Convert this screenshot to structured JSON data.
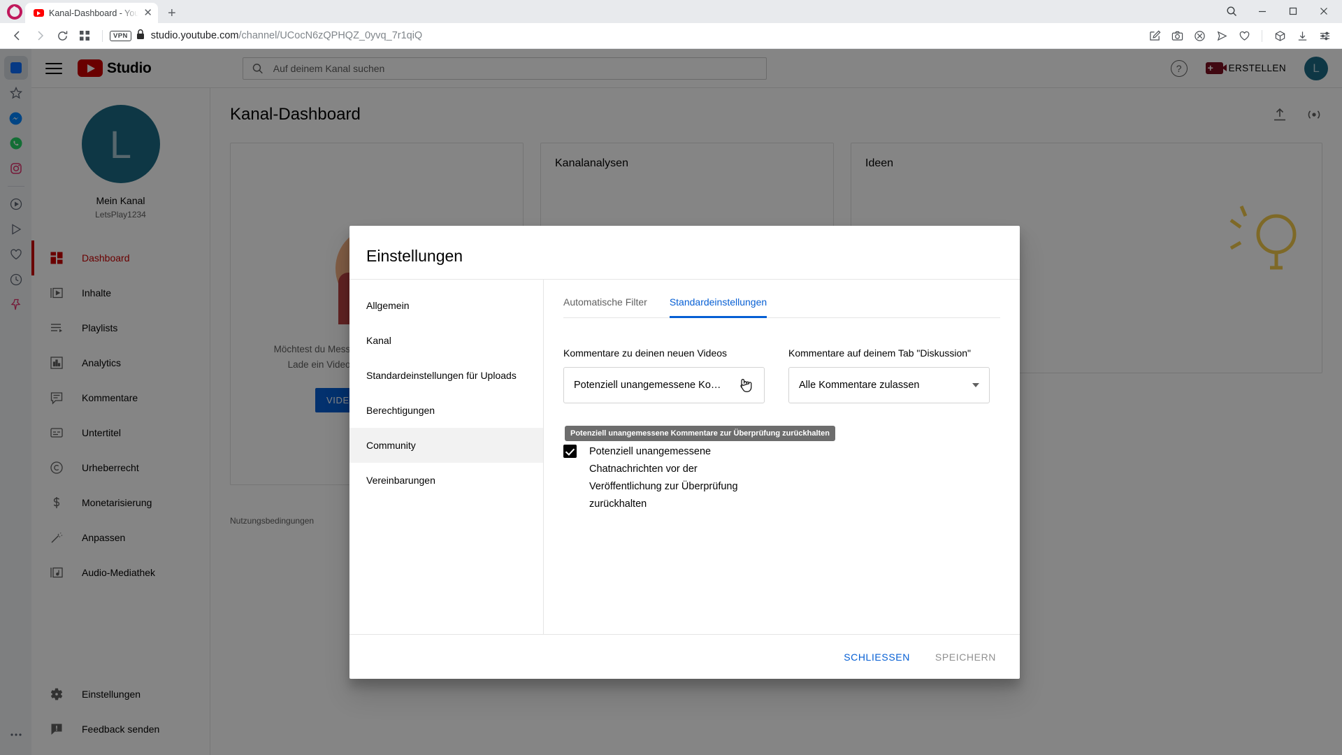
{
  "browser": {
    "name": "Opera",
    "tab": {
      "title": "Kanal-Dashboard - YouTub",
      "favicon": "youtube-icon",
      "close": "✕"
    },
    "new_tab": "+",
    "window_controls": {
      "search": "search-icon",
      "minimize": "–",
      "maximize": "❐",
      "close": "✕"
    },
    "nav": {
      "back": "‹",
      "forward": "›",
      "reload": "↻",
      "tiles": "grid-icon",
      "vpn_badge": "VPN",
      "lock": "lock-icon",
      "url_host": "studio.youtube.com",
      "url_path": "/channel/UCocN6zQPHQZ_0yvq_7r1qiQ",
      "right_icons": [
        "edit-page-icon",
        "screenshot-icon",
        "adblock-icon",
        "send-icon",
        "heart-icon",
        "package-icon",
        "download-icon",
        "settings-sliders-icon"
      ]
    },
    "sidebar_icons": [
      "opera-home-icon",
      "star-icon",
      "messenger-icon",
      "whatsapp-icon",
      "instagram-icon",
      "player-icon",
      "video-icon",
      "heart-icon",
      "history-icon",
      "pin-icon",
      "more-icon"
    ]
  },
  "studio": {
    "header": {
      "menu": "hamburger-icon",
      "logo_text": "Studio",
      "search_placeholder": "Auf deinem Kanal suchen",
      "search_value": "",
      "help": "?",
      "create_label": "ERSTELLEN",
      "avatar_letter": "L"
    },
    "nav": {
      "channel": {
        "avatar_letter": "L",
        "name": "Mein Kanal",
        "handle": "LetsPlay1234"
      },
      "items": [
        {
          "label": "Dashboard",
          "icon": "dashboard-icon",
          "active": true
        },
        {
          "label": "Inhalte",
          "icon": "content-icon",
          "active": false
        },
        {
          "label": "Playlists",
          "icon": "playlist-icon",
          "active": false
        },
        {
          "label": "Analytics",
          "icon": "analytics-icon",
          "active": false
        },
        {
          "label": "Kommentare",
          "icon": "comments-icon",
          "active": false
        },
        {
          "label": "Untertitel",
          "icon": "subtitles-icon",
          "active": false
        },
        {
          "label": "Urheberrecht",
          "icon": "copyright-icon",
          "active": false
        },
        {
          "label": "Monetarisierung",
          "icon": "dollar-icon",
          "active": false
        },
        {
          "label": "Anpassen",
          "icon": "magic-wand-icon",
          "active": false
        },
        {
          "label": "Audio-Mediathek",
          "icon": "audio-library-icon",
          "active": false
        }
      ],
      "bottom_items": [
        {
          "label": "Einstellungen",
          "icon": "gear-icon"
        },
        {
          "label": "Feedback senden",
          "icon": "feedback-icon"
        }
      ]
    },
    "main": {
      "title": "Kanal-Dashboard",
      "actions": [
        "upload-icon",
        "go-live-icon"
      ],
      "card_upload": {
        "text_line1": "Möchtest du Messwerte zu deinem Video sehen?",
        "text_line2": "Lade ein Video hoch und veröffentliche es.",
        "button": "VIDEOS HOCHLADEN"
      },
      "card_analytics_title": "Kanalanalysen",
      "card_ideas_title": "Ideen",
      "terms": "Nutzungsbedingungen"
    }
  },
  "dialog": {
    "title": "Einstellungen",
    "sidebar": [
      {
        "label": "Allgemein",
        "active": false
      },
      {
        "label": "Kanal",
        "active": false
      },
      {
        "label": "Standardeinstellungen für Uploads",
        "active": false
      },
      {
        "label": "Berechtigungen",
        "active": false
      },
      {
        "label": "Community",
        "active": true
      },
      {
        "label": "Vereinbarungen",
        "active": false
      }
    ],
    "tabs": [
      {
        "label": "Automatische Filter",
        "active": false
      },
      {
        "label": "Standardeinstellungen",
        "active": true
      }
    ],
    "fields": [
      {
        "label": "Kommentare zu deinen neuen Videos",
        "value": "Potenziell unangemessene Ko…",
        "has_caret": false
      },
      {
        "label": "Kommentare auf deinem Tab \"Diskussion\"",
        "value": "Alle Kommentare zulassen",
        "has_caret": true
      }
    ],
    "tooltip": "Potenziell unangemessene Kommentare zur Überprüfung zurückhalten",
    "checkbox": {
      "checked": true,
      "label": "Potenziell unangemessene Chatnachrichten vor der Veröffentlichung zur Überprüfung zurückhalten"
    },
    "footer": {
      "close": "SCHLIESSEN",
      "save": "SPEICHERN"
    }
  },
  "colors": {
    "youtube_red": "#cc0000",
    "accent_blue": "#065fd4",
    "avatar_teal": "#1b6a85",
    "opera_red": "#c0185c"
  }
}
